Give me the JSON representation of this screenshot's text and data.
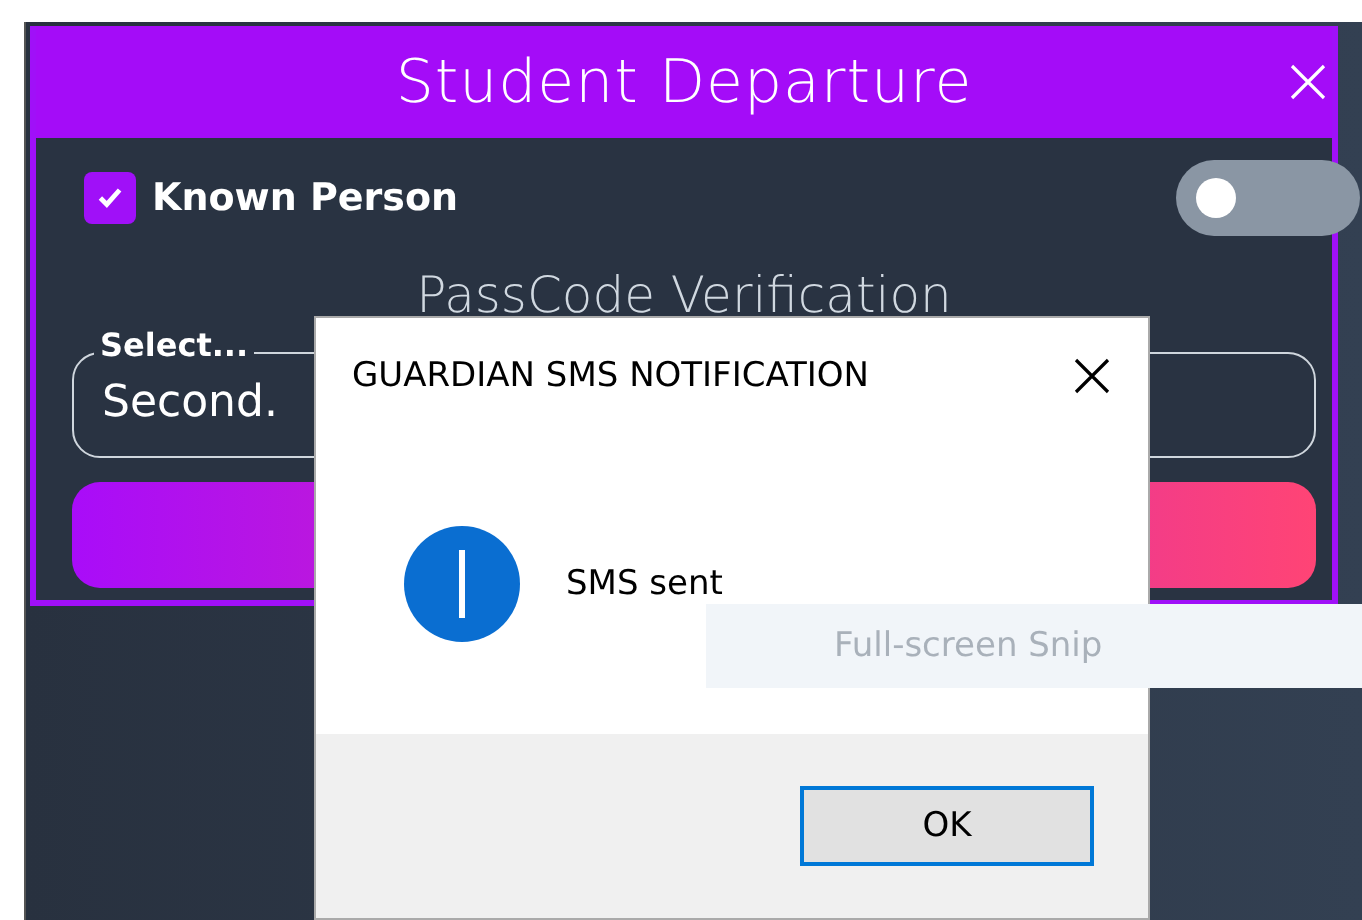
{
  "window": {
    "title": "Student Departure"
  },
  "known_person": {
    "label": "Known Person",
    "checked": true
  },
  "toggle": {
    "on": false
  },
  "passcode": {
    "title": "PassCode Verification",
    "select": {
      "label": "Select...",
      "value": "Second."
    }
  },
  "dialog": {
    "title": "GUARDIAN SMS NOTIFICATION",
    "message": "SMS sent",
    "buttons": [
      "OK"
    ]
  },
  "tooltip": {
    "text": "Full-screen Snip"
  }
}
